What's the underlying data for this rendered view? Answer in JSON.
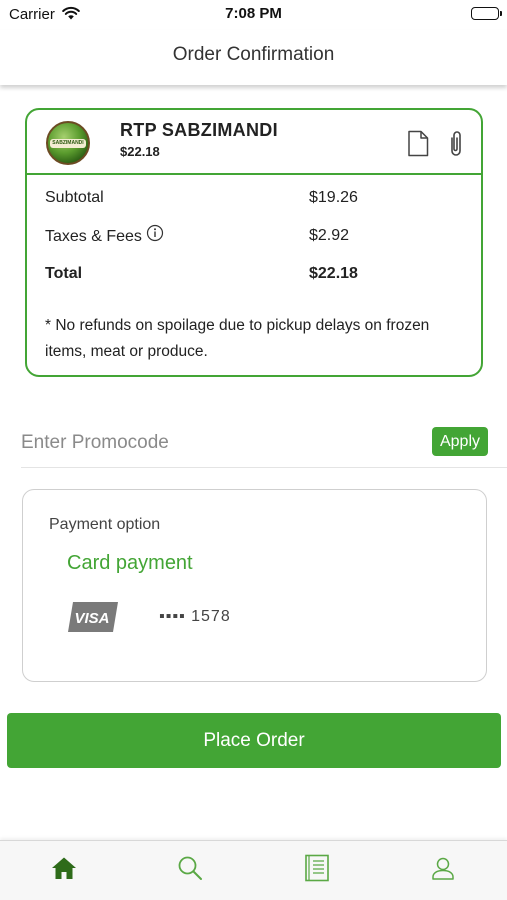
{
  "status_bar": {
    "carrier": "Carrier",
    "time": "7:08 PM",
    "battery_level": 1.0
  },
  "header": {
    "title": "Order Confirmation"
  },
  "order": {
    "store_name": "RTP SABZIMANDI",
    "store_total": "$22.18",
    "logo_text": "SABZIMANDI",
    "rows": [
      {
        "label": "Subtotal",
        "value": "$19.26"
      },
      {
        "label": "Taxes & Fees",
        "value": "$2.92"
      },
      {
        "label": "Total",
        "value": "$22.18"
      }
    ],
    "note": "* No refunds on spoilage due to pickup delays on frozen items, meat or produce."
  },
  "promo": {
    "placeholder": "Enter Promocode",
    "value": "",
    "apply_label": "Apply"
  },
  "payment": {
    "label": "Payment option",
    "method": "Card payment",
    "card_brand": "VISA",
    "card_mask": "▪▪▪▪ 1578"
  },
  "actions": {
    "place_order_label": "Place Order"
  },
  "tab_bar": {
    "items": [
      {
        "icon": "home-icon",
        "active": true
      },
      {
        "icon": "search-icon",
        "active": false
      },
      {
        "icon": "orders-icon",
        "active": false
      },
      {
        "icon": "profile-icon",
        "active": false
      }
    ]
  },
  "colors": {
    "accent": "#43a535",
    "active_tab": "#2e6b1a",
    "border": "#cfcfcf"
  }
}
